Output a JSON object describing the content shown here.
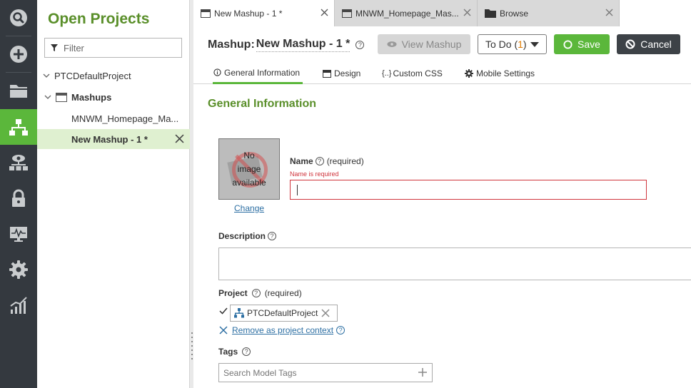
{
  "rail": {
    "items": [
      "search-icon",
      "add-icon",
      "folder-icon",
      "mashup-icon",
      "monitor-eye-icon",
      "lock-icon",
      "monitoring-icon",
      "gear-icon",
      "analytics-icon"
    ],
    "active": "mashup-icon",
    "accent": "#5bb73b"
  },
  "projects": {
    "title": "Open Projects",
    "filter_placeholder": "Filter",
    "tree": {
      "project": "PTCDefaultProject",
      "group": "Mashups",
      "items": [
        "MNWM_Homepage_Ma...",
        "New Mashup - 1 *"
      ]
    }
  },
  "tabs": [
    {
      "label": "New Mashup - 1 *",
      "icon": "mashup-icon"
    },
    {
      "label": "MNWM_Homepage_Mas...",
      "icon": "mashup-icon"
    },
    {
      "label": "Browse",
      "icon": "folder-icon"
    }
  ],
  "header": {
    "prefix": "Mashup:",
    "name": "New Mashup - 1 *",
    "help_glyph": "?",
    "view_label": "View Mashup",
    "todo_label": "To Do (",
    "todo_count": "1",
    "todo_close": ")",
    "save_label": "Save",
    "cancel_label": "Cancel"
  },
  "subtabs": [
    "General Information",
    "Design",
    "Custom CSS",
    "Mobile Settings"
  ],
  "subtab_custom_css_glyph": "{..}",
  "general": {
    "section_title": "General Information",
    "image_text": [
      "No",
      "image",
      "available"
    ],
    "change_link": "Change",
    "name_label": "Name",
    "required": "(required)",
    "name_error": "Name is required",
    "name_value": "",
    "description_label": "Description",
    "description_value": "",
    "project_label": "Project",
    "project_value": "PTCDefaultProject",
    "remove_link": "Remove as project context",
    "tags_label": "Tags",
    "tags_placeholder": "Search Model Tags"
  }
}
